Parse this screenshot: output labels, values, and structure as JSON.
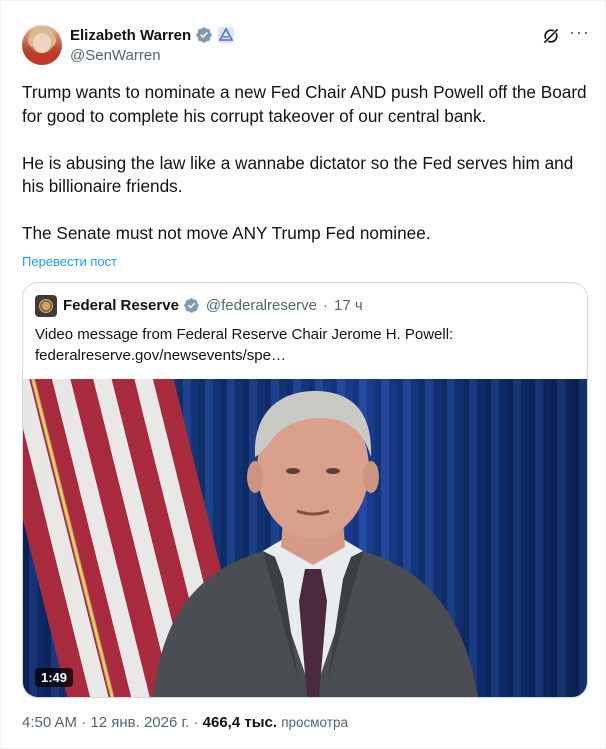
{
  "author": {
    "display_name": "Elizabeth Warren",
    "handle": "@SenWarren",
    "verified_color": "#829aab",
    "gov_badge_color": "#536fc8"
  },
  "tweet": {
    "paragraphs": [
      "Trump wants to nominate a new Fed Chair AND push Powell off the Board for good to complete his corrupt takeover of our central bank.",
      "He is abusing the law like a wannabe dictator so the Fed serves him and his billionaire friends.",
      "The Senate must not move ANY Trump Fed nominee."
    ],
    "translate_label": "Перевести пост"
  },
  "quote": {
    "display_name": "Federal Reserve",
    "handle": "@federalreserve",
    "separator": "·",
    "time": "17 ч",
    "text_line1": "Video message from Federal Reserve Chair Jerome H. Powell:",
    "text_line2": "federalreserve.gov/newsevents/spe…",
    "video_duration": "1:49"
  },
  "footer": {
    "time": "4:50 AM",
    "separator": "·",
    "date": "12 янв. 2026 г.",
    "views_count": "466,4 тыс.",
    "views_label": "просмотра"
  },
  "icons": {
    "grok": "grok-icon",
    "more": "more-icon",
    "verified": "verified-icon",
    "gov": "gov-badge-icon"
  },
  "colors": {
    "link_blue": "#1d9bf0",
    "secondary_text": "#536471",
    "primary_text": "#0f1419"
  }
}
